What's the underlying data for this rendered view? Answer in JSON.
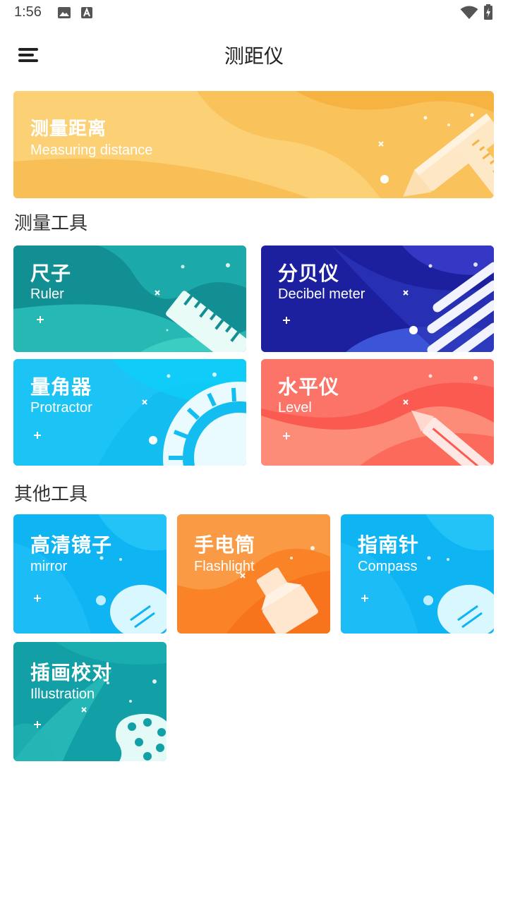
{
  "status_bar": {
    "time": "1:56"
  },
  "app_bar": {
    "title": "测距仪"
  },
  "hero": {
    "title_zh": "测量距离",
    "title_en": "Measuring distance"
  },
  "sections": {
    "measure_tools": "测量工具",
    "other_tools": "其他工具"
  },
  "tools": {
    "ruler": {
      "title_zh": "尺子",
      "title_en": "Ruler"
    },
    "decibel": {
      "title_zh": "分贝仪",
      "title_en": "Decibel meter"
    },
    "protractor": {
      "title_zh": "量角器",
      "title_en": "Protractor"
    },
    "level": {
      "title_zh": "水平仪",
      "title_en": "Level"
    },
    "mirror": {
      "title_zh": "高清镜子",
      "title_en": "mirror"
    },
    "flashlight": {
      "title_zh": "手电筒",
      "title_en": "Flashlight"
    },
    "compass": {
      "title_zh": "指南针",
      "title_en": "Compass"
    },
    "illustration": {
      "title_zh": "插画校对",
      "title_en": "Illustration"
    }
  },
  "colors": {
    "hero": "#f7b84a",
    "ruler": "#169c9c",
    "decibel": "#2a2fb5",
    "protractor": "#12bff2",
    "level": "#fb6156",
    "mirror": "#12b8f5",
    "flashlight": "#fa8a2e",
    "compass": "#12b8f5",
    "illustration": "#17a3a8"
  }
}
